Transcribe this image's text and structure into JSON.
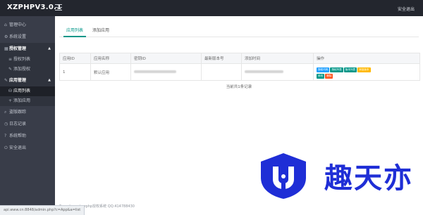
{
  "app": {
    "title": "XZPHPV3.0.1",
    "logout_top": "安全退出"
  },
  "sidebar": {
    "items": [
      {
        "label": "管理中心",
        "icon": "home-icon"
      },
      {
        "label": "系统设置",
        "icon": "gear-icon"
      },
      {
        "label": "授权管理",
        "icon": "grid-icon",
        "group": true
      },
      {
        "label": "授权列表",
        "icon": "list-icon",
        "sub": true
      },
      {
        "label": "添加授权",
        "icon": "edit-icon",
        "sub": true
      },
      {
        "label": "应用管理",
        "icon": "edit-icon",
        "group": true
      },
      {
        "label": "应用列表",
        "icon": "database-icon",
        "sub": true,
        "active": true
      },
      {
        "label": "添加应用",
        "icon": "plus-icon",
        "sub": true
      },
      {
        "label": "盗版跟踪",
        "icon": "track-icon"
      },
      {
        "label": "日志记录",
        "icon": "log-icon"
      },
      {
        "label": "系统帮助",
        "icon": "help-icon"
      },
      {
        "label": "安全退出",
        "icon": "logout-icon"
      }
    ]
  },
  "tabs": [
    {
      "label": "应用列表",
      "active": true
    },
    {
      "label": "添加应用"
    }
  ],
  "table": {
    "headers": [
      "应用ID",
      "应用名称",
      "密钥ID",
      "最新版本号",
      "添加时间",
      "操作"
    ],
    "rows": [
      {
        "id": "1",
        "name": "默认应用"
      }
    ],
    "actions": [
      {
        "label": "授权代码",
        "color": "#1e9fff"
      },
      {
        "label": "授权列表",
        "color": "#009688"
      },
      {
        "label": "版本列表",
        "color": "#009688"
      },
      {
        "label": "添加版本",
        "color": "#ffb800"
      },
      {
        "label": "修改",
        "color": "#009688"
      },
      {
        "label": "删除",
        "color": "#ff5722"
      }
    ]
  },
  "footer": {
    "count_text": "当前共1条记录"
  },
  "status_bar": {
    "url": "api.www.cn:8848/admin.php?c=App&a=list"
  },
  "copyright": "© xzphp.net xzphp授权系统 QQ:414788430",
  "watermark": {
    "text": "趣天亦"
  },
  "colors": {
    "primary": "#009688",
    "topbar": "#23262e",
    "sidebar": "#393d49",
    "watermark": "#1f2ed6"
  }
}
